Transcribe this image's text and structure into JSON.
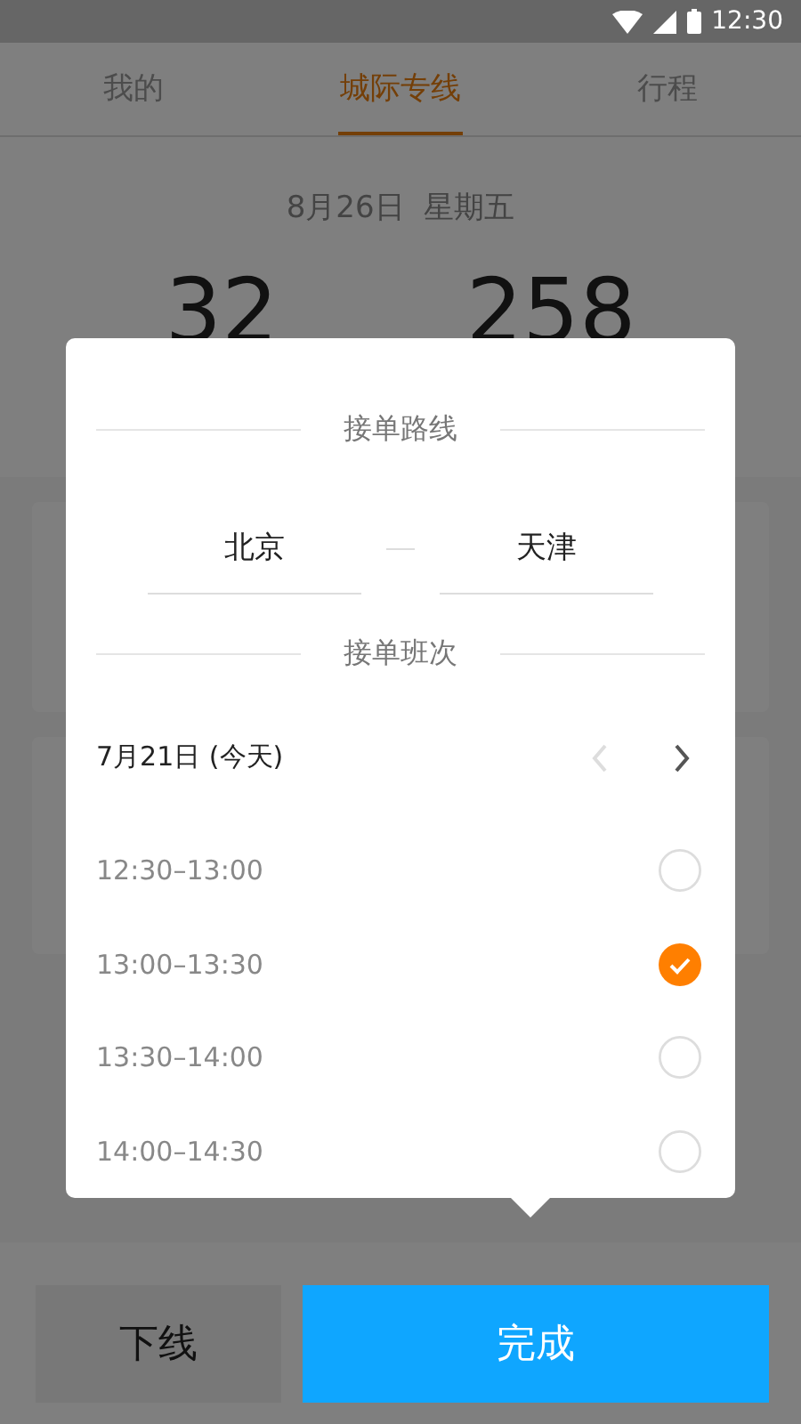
{
  "status_bar": {
    "time": "12:30"
  },
  "tabs": [
    {
      "label": "我的",
      "selected": false
    },
    {
      "label": "城际专线",
      "selected": true
    },
    {
      "label": "行程",
      "selected": false
    }
  ],
  "date": "8月26日  星期五",
  "stats": [
    "32",
    "258"
  ],
  "dialog": {
    "route_title": "接单路线",
    "from": "北京",
    "to": "天津",
    "shift_title": "接单班次",
    "day": "7月21日 (今天)",
    "prev_disabled": true,
    "next_disabled": false,
    "slots": [
      {
        "time": "12:30–13:00",
        "selected": false
      },
      {
        "time": "13:00–13:30",
        "selected": true
      },
      {
        "time": "13:30–14:00",
        "selected": false
      },
      {
        "time": "14:00–14:30",
        "selected": false
      }
    ]
  },
  "buttons": {
    "offline": "下线",
    "done": "完成"
  }
}
